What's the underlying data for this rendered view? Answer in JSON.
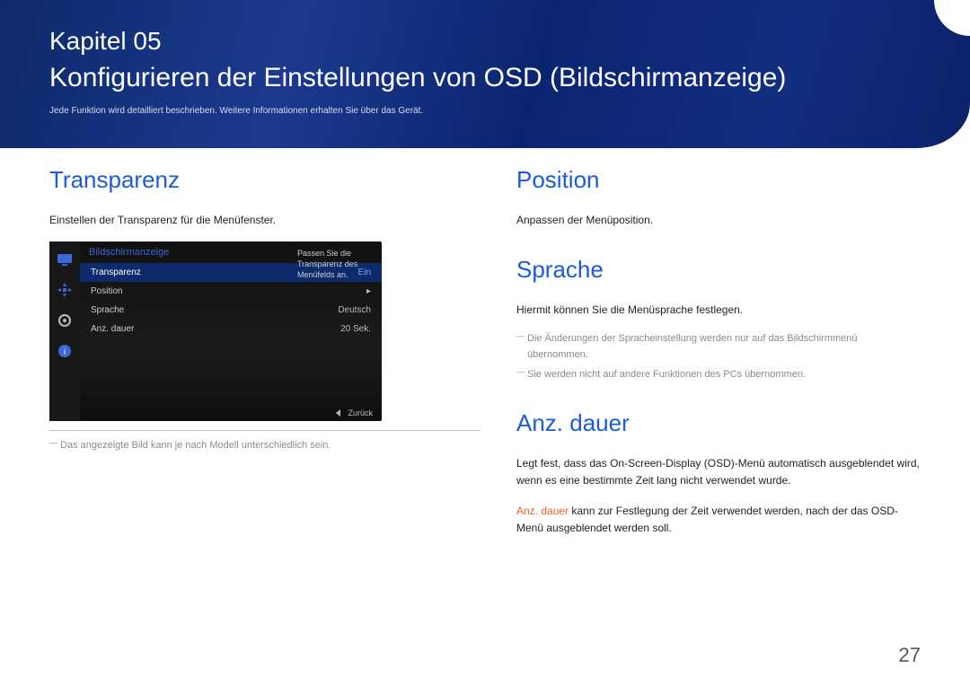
{
  "header": {
    "chapter_label": "Kapitel 05",
    "title": "Konfigurieren der Einstellungen von OSD (Bildschirmanzeige)",
    "subtitle": "Jede Funktion wird detailliert beschrieben. Weitere Informationen erhalten Sie über das Gerät."
  },
  "left": {
    "transparenz": {
      "heading": "Transparenz",
      "desc": "Einstellen der Transparenz für die Menüfenster.",
      "footnote": "Das angezeigte Bild kann je nach Modell unterschiedlich sein."
    }
  },
  "osd": {
    "title": "Bildschirmanzeige",
    "help": "Passen Sie die Transparenz des Menüfelds an.",
    "rows": [
      {
        "label": "Transparenz",
        "value": "Ein"
      },
      {
        "label": "Position",
        "value": "▸"
      },
      {
        "label": "Sprache",
        "value": "Deutsch"
      },
      {
        "label": "Anz. dauer",
        "value": "20 Sek."
      }
    ],
    "footer_label": "Zurück"
  },
  "right": {
    "position": {
      "heading": "Position",
      "desc": "Anpassen der Menüposition."
    },
    "sprache": {
      "heading": "Sprache",
      "desc": "Hiermit können Sie die Menüsprache festlegen.",
      "note1": "Die Änderungen der Spracheinstellung werden nur auf das Bildschirmmenü übernommen.",
      "note2": "Sie werden nicht auf andere Funktionen des PCs übernommen."
    },
    "anzdauer": {
      "heading": "Anz. dauer",
      "desc1": "Legt fest, dass das On-Screen-Display (OSD)-Menü automatisch ausgeblendet wird, wenn es eine bestimmte Zeit lang nicht verwendet wurde.",
      "desc2_em": "Anz. dauer",
      "desc2_rest": " kann zur Festlegung der Zeit verwendet werden, nach der das OSD-Menü ausgeblendet werden soll."
    }
  },
  "page_number": "27"
}
